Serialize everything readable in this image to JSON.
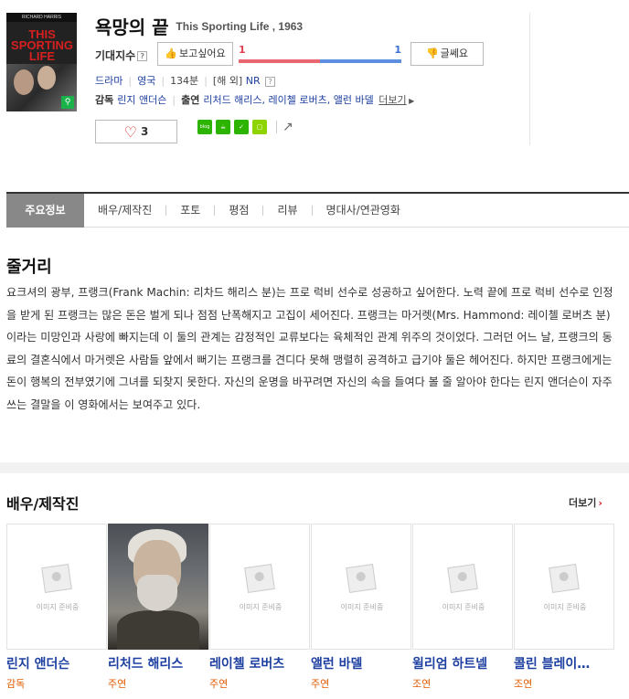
{
  "poster": {
    "top_text": "RICHARD HARRIS",
    "title_art": "THIS SPORTING LIFE"
  },
  "movie": {
    "title_ko": "욕망의 끝",
    "title_en": "This Sporting Life , 1963"
  },
  "expect": {
    "label": "기대지수",
    "help": "?",
    "want_label": "보고싶어요",
    "want_count": "1",
    "nope_count": "1",
    "nope_label": "글쎄요",
    "want_ratio": 0.5
  },
  "meta": {
    "genre": "드라마",
    "country": "영국",
    "runtime": "134분",
    "release": "[해 외]",
    "rating": "NR",
    "rating_help": "?"
  },
  "credits": {
    "director_label": "감독",
    "director": "린지 앤더슨",
    "cast_label": "출연",
    "cast": "리처드 해리스, 레이첼 로버츠, 앨런 바델",
    "more": "더보기"
  },
  "like": {
    "count": "3"
  },
  "share": {
    "blog_label": "blog"
  },
  "tabs": [
    {
      "label": "주요정보"
    },
    {
      "label": "배우/제작진"
    },
    {
      "label": "포토"
    },
    {
      "label": "평점"
    },
    {
      "label": "리뷰"
    },
    {
      "label": "명대사/연관영화"
    }
  ],
  "synopsis": {
    "title": "줄거리",
    "text": "요크셔의 광부, 프랭크(Frank Machin: 리차드 해리스 분)는 프로 럭비 선수로 성공하고 싶어한다. 노력 끝에 프로 럭비 선수로 인정을 받게 된 프랭크는 많은 돈은 벌게 되나 점점 난폭해지고 고집이 세어진다. 프랭크는 마거렛(Mrs. Hammond: 레이첼 로버츠 분)이라는 미망인과 사랑에 빠지는데 이 둘의 관계는 감정적인 교류보다는 육체적인 관계 위주의 것이었다. 그러던 어느 날, 프랭크의 동료의 결혼식에서 마거렛은 사람들 앞에서 뻐기는 프랭크를 견디다 못해 맹렬히 공격하고 급기야 둘은 헤어진다. 하지만 프랭크에게는 돈이 행복의 전부였기에 그녀를 되찾지 못한다. 자신의 운명을 바꾸려면 자신의 속을 들여다 볼 줄 알아야 한다는 린지 앤더슨이 자주 쓰는 결말을 이 영화에서는 보여주고 있다."
  },
  "cast_section": {
    "title": "배우/제작진",
    "more": "더보기",
    "placeholder": "이미지 준비중",
    "people": [
      {
        "name": "린지 앤더슨",
        "role": "감독"
      },
      {
        "name": "리처드 해리스",
        "role": "주연"
      },
      {
        "name": "레이첼 로버츠",
        "role": "주연"
      },
      {
        "name": "앨런 바델",
        "role": "주연"
      },
      {
        "name": "윌리엄 하트넬",
        "role": "조연"
      },
      {
        "name": "콜린 블레이…",
        "role": "조연"
      }
    ]
  }
}
